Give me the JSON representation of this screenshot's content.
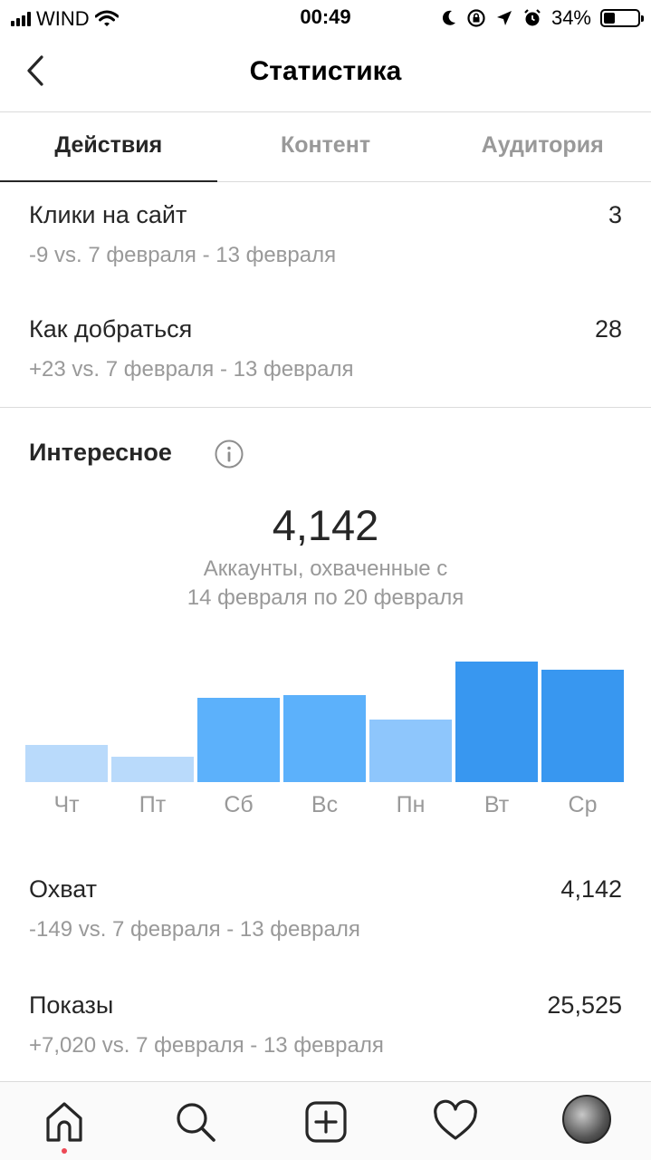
{
  "status_bar": {
    "carrier": "WIND",
    "time": "00:49",
    "battery": "34%",
    "battery_level": 0.34
  },
  "header": {
    "title": "Статистика"
  },
  "tabs": [
    {
      "label": "Действия",
      "active": true
    },
    {
      "label": "Контент",
      "active": false
    },
    {
      "label": "Аудитория",
      "active": false
    }
  ],
  "actions": [
    {
      "label": "Клики на сайт",
      "value": "3",
      "delta": "-9 vs. 7 февраля - 13 февраля"
    },
    {
      "label": "Как добраться",
      "value": "28",
      "delta": "+23 vs. 7 февраля - 13 февраля"
    }
  ],
  "discovery": {
    "title": "Интересное",
    "total": "4,142",
    "caption_line1": "Аккаунты, охваченные с",
    "caption_line2": "14 февраля по 20 февраля"
  },
  "chart_data": {
    "type": "bar",
    "categories": [
      "Чт",
      "Пт",
      "Сб",
      "Вс",
      "Пн",
      "Вт",
      "Ср"
    ],
    "values": [
      0.31,
      0.21,
      0.7,
      0.72,
      0.52,
      1.0,
      0.93
    ],
    "colors": [
      "#b9dafb",
      "#b9dafb",
      "#5cb1fb",
      "#5cb1fb",
      "#8ec6fc",
      "#3897f0",
      "#3897f0"
    ],
    "title": "",
    "xlabel": "",
    "ylabel": "",
    "ylim": [
      0,
      1
    ]
  },
  "reach": [
    {
      "label": "Охват",
      "value": "4,142",
      "delta": "-149 vs. 7 февраля - 13 февраля"
    },
    {
      "label": "Показы",
      "value": "25,525",
      "delta": "+7,020 vs. 7 февраля - 13 февраля"
    }
  ],
  "bottom_nav": {
    "items": [
      "home-icon",
      "search-icon",
      "new-post-icon",
      "activity-heart-icon",
      "profile-avatar"
    ],
    "notification_color": "#ed4956"
  }
}
